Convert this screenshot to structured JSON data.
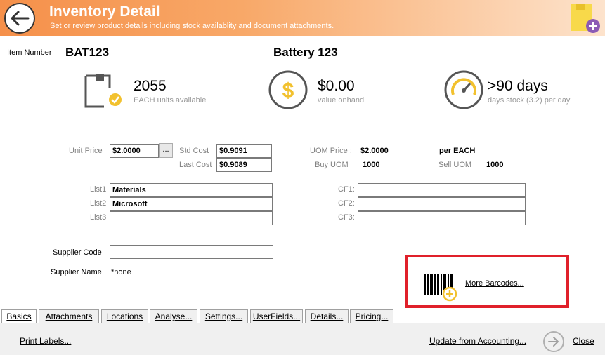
{
  "header": {
    "title": "Inventory Detail",
    "subtitle": "Set or review product details including stock availablity and document attachments."
  },
  "item": {
    "number_label": "Item Number",
    "number": "BAT123",
    "name": "Battery 123"
  },
  "stats": {
    "units": "2055",
    "units_caption": "EACH units available",
    "value": "$0.00",
    "value_caption": "value onhand",
    "days": ">90 days",
    "days_caption": "days stock (3.2) per day"
  },
  "pricing": {
    "unit_price_label": "Unit Price",
    "unit_price": "$2.0000",
    "ellipsis": "...",
    "std_cost_label": "Std Cost",
    "std_cost": "$0.9091",
    "last_cost_label": "Last Cost",
    "last_cost": "$0.9089",
    "uom_price_label": "UOM Price :",
    "uom_price": "$2.0000",
    "per_label": "per EACH",
    "buy_uom_label": "Buy UOM",
    "buy_uom": "1000",
    "sell_uom_label": "Sell UOM",
    "sell_uom": "1000"
  },
  "lists": {
    "list1_label": "List1",
    "list1": "Materials",
    "list2_label": "List2",
    "list2": "Microsoft",
    "list3_label": "List3",
    "list3": "",
    "cf1_label": "CF1:",
    "cf1": "",
    "cf2_label": "CF2:",
    "cf2": "",
    "cf3_label": "CF3:",
    "cf3": ""
  },
  "supplier": {
    "code_label": "Supplier Code",
    "code": "",
    "name_label": "Supplier Name",
    "name": "*none"
  },
  "barcodes": {
    "more_label": "More Barcodes..."
  },
  "tabs": [
    "Basics",
    "Attachments",
    "Locations",
    "Analyse...",
    "Settings...",
    "UserFields...",
    "Details...",
    "Pricing..."
  ],
  "footer": {
    "print_labels": "Print Labels...",
    "update_accounting": "Update from Accounting...",
    "close": "Close"
  },
  "colors": {
    "header_orange": "#f5904a",
    "accent_yellow": "#f2c12e",
    "highlight_red": "#e0202a"
  }
}
